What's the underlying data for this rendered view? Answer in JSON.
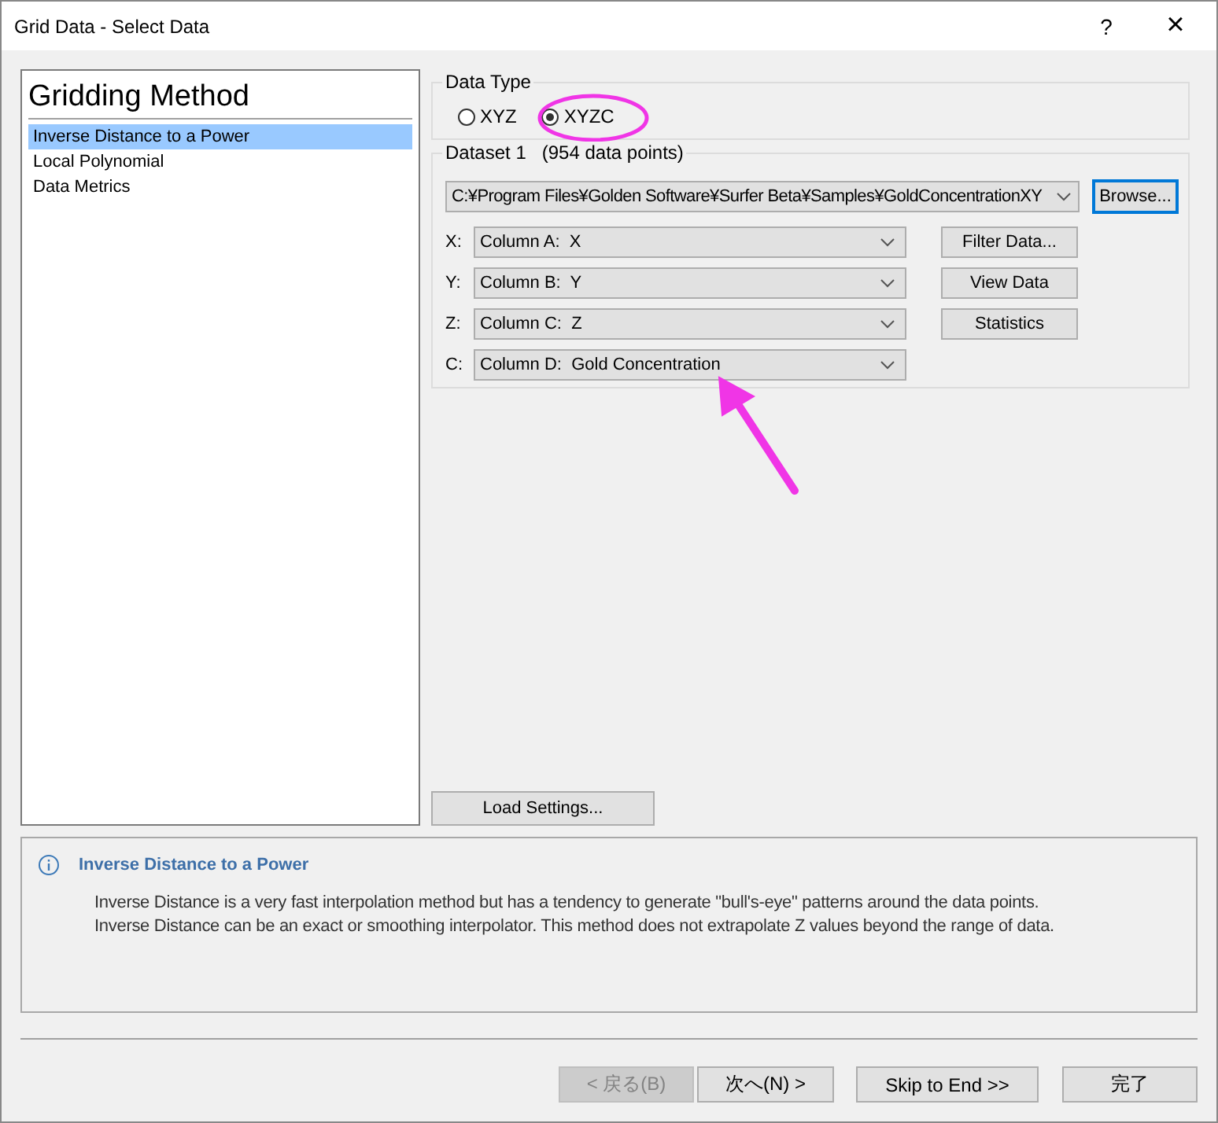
{
  "window": {
    "title": "Grid Data - Select Data",
    "help": "?",
    "close": "×"
  },
  "methods": {
    "heading": "Gridding Method",
    "items": [
      {
        "label": "Inverse Distance to a Power",
        "selected": true
      },
      {
        "label": "Local Polynomial",
        "selected": false
      },
      {
        "label": "Data Metrics",
        "selected": false
      }
    ]
  },
  "data_type": {
    "legend": "Data Type",
    "options": [
      {
        "label": "XYZ",
        "selected": false
      },
      {
        "label": "XYZC",
        "selected": true
      }
    ]
  },
  "dataset": {
    "legend": "Dataset 1",
    "count": "(954 data points)",
    "file": "C:¥Program Files¥Golden Software¥Surfer Beta¥Samples¥GoldConcentrationXY",
    "browse": "Browse...",
    "columns": [
      {
        "axis": "X:",
        "value": "Column A:  X"
      },
      {
        "axis": "Y:",
        "value": "Column B:  Y"
      },
      {
        "axis": "Z:",
        "value": "Column C:  Z"
      },
      {
        "axis": "C:",
        "value": "Column D:  Gold Concentration"
      }
    ],
    "buttons": [
      "Filter Data...",
      "View Data",
      "Statistics"
    ]
  },
  "load_settings": "Load Settings...",
  "info": {
    "title": "Inverse Distance to a Power",
    "lines": [
      "Inverse Distance is a very fast interpolation method but has a tendency to generate \"bull's-eye\" patterns around the data points.",
      "Inverse Distance can be an exact or smoothing interpolator. This method does not extrapolate Z values beyond the range of data."
    ]
  },
  "footer": [
    {
      "label": "< 戻る(B)",
      "disabled": true
    },
    {
      "label": "次へ(N) >",
      "disabled": false
    },
    {
      "label": "Skip to End >>",
      "disabled": false
    },
    {
      "label": "完了",
      "disabled": false
    }
  ]
}
